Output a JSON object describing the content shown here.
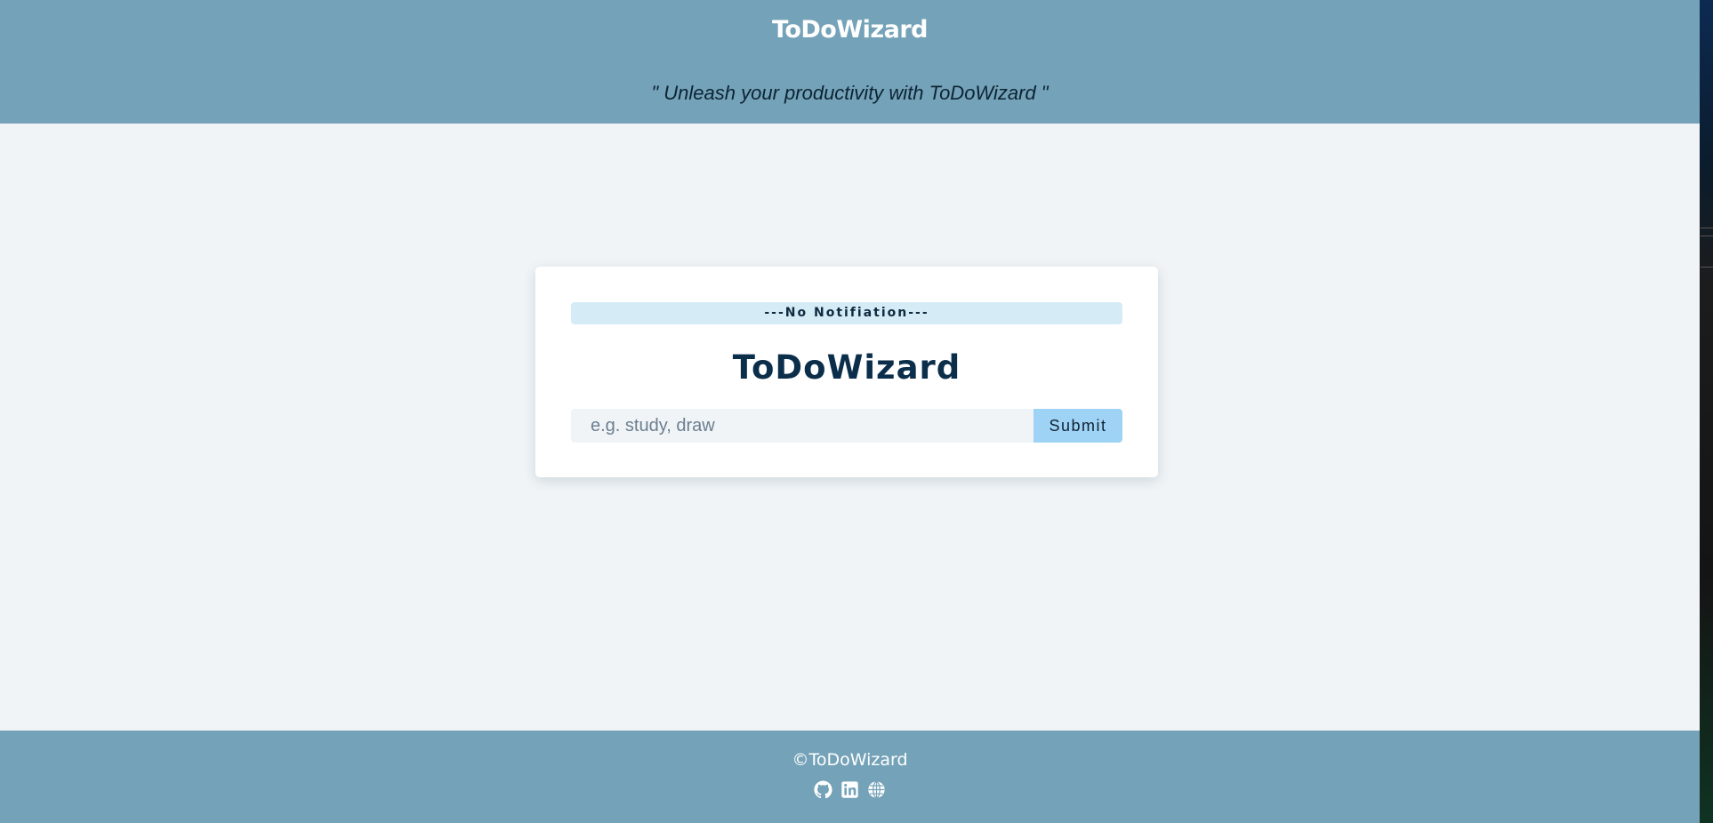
{
  "header": {
    "brand": "ToDoWizard",
    "tagline": "\" Unleash your productivity with ToDoWizard \""
  },
  "card": {
    "notification": "---No Notifiation---",
    "title": "ToDoWizard",
    "input": {
      "placeholder": "e.g. study, draw",
      "value": ""
    },
    "submit_label": "Submit"
  },
  "footer": {
    "copyright": "©ToDoWizard",
    "links": [
      {
        "icon": "github-icon"
      },
      {
        "icon": "linkedin-icon"
      },
      {
        "icon": "globe-icon"
      }
    ]
  },
  "colors": {
    "header_bg": "#74a2b8",
    "page_bg": "#f0f4f7",
    "notification_bg": "#d5ecf7",
    "title_color": "#0b2f4b",
    "submit_bg": "#9fd3f5"
  }
}
